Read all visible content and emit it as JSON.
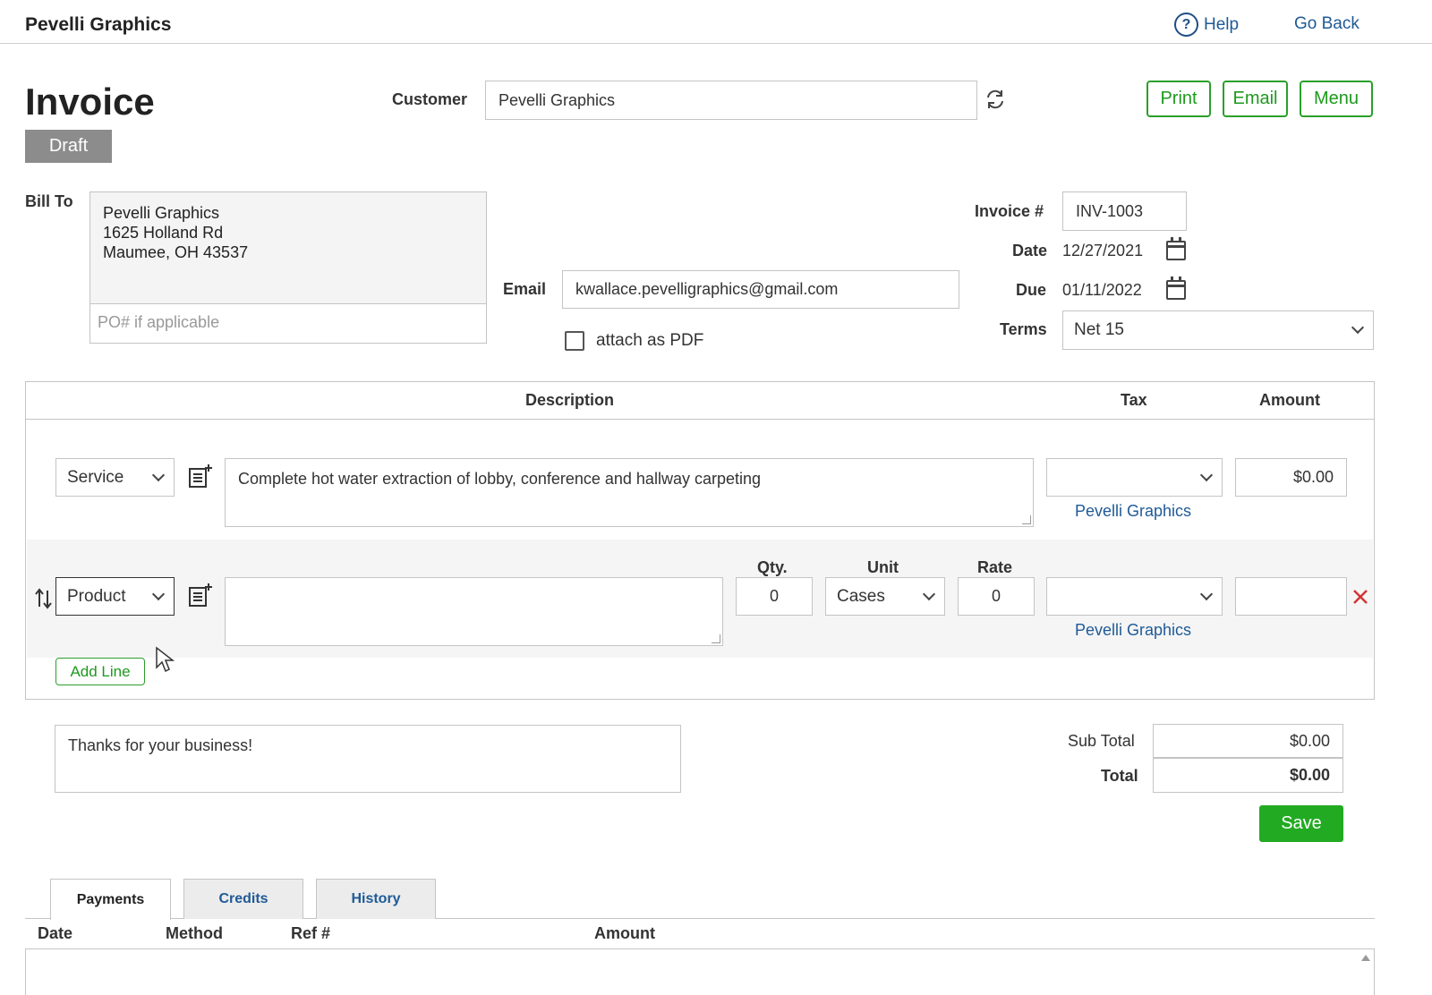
{
  "header": {
    "brand": "Pevelli Graphics",
    "help_label": "Help",
    "go_back_label": "Go Back"
  },
  "invoice": {
    "title": "Invoice",
    "status": "Draft",
    "customer_label": "Customer",
    "customer_value": "Pevelli Graphics",
    "actions": {
      "print": "Print",
      "email": "Email",
      "menu": "Menu"
    },
    "bill_to_label": "Bill To",
    "bill_to_address": "Pevelli Graphics\n1625 Holland Rd\nMaumee, OH 43537",
    "po_placeholder": "PO# if applicable",
    "email_label": "Email",
    "email_value": "kwallace.pevelligraphics@gmail.com",
    "attach_pdf_label": "attach as PDF",
    "attach_pdf_checked": false,
    "invoice_no_label": "Invoice #",
    "invoice_no_value": "INV-1003",
    "date_label": "Date",
    "date_value": "12/27/2021",
    "due_label": "Due",
    "due_value": "01/11/2022",
    "terms_label": "Terms",
    "terms_value": "Net 15"
  },
  "lines": {
    "headers": {
      "description": "Description",
      "tax": "Tax",
      "amount": "Amount"
    },
    "sub_headers": {
      "qty": "Qty.",
      "unit": "Unit",
      "rate": "Rate"
    },
    "row1": {
      "type": "Service",
      "description": "Complete hot water extraction of lobby, conference and hallway carpeting",
      "tax": "",
      "tax_link": "Pevelli Graphics",
      "amount": "$0.00"
    },
    "row2": {
      "type": "Product",
      "description": "",
      "qty": "0",
      "unit": "Cases",
      "rate": "0",
      "tax": "",
      "tax_link": "Pevelli Graphics",
      "amount": ""
    },
    "add_line_label": "Add Line"
  },
  "footer": {
    "note": "Thanks for your business!",
    "subtotal_label": "Sub Total",
    "subtotal_value": "$0.00",
    "total_label": "Total",
    "total_value": "$0.00",
    "save_label": "Save"
  },
  "tabs": [
    {
      "label": "Payments",
      "active": true
    },
    {
      "label": "Credits",
      "active": false
    },
    {
      "label": "History",
      "active": false
    }
  ],
  "payments_table": {
    "columns": [
      "Date",
      "Method",
      "Ref #",
      "Amount"
    ]
  },
  "colors": {
    "accent_green": "#1d9a1d",
    "save_green": "#22aa22",
    "link_blue": "#1f5a96",
    "draft_gray": "#8c8c8c",
    "delete_red": "#d33333"
  }
}
